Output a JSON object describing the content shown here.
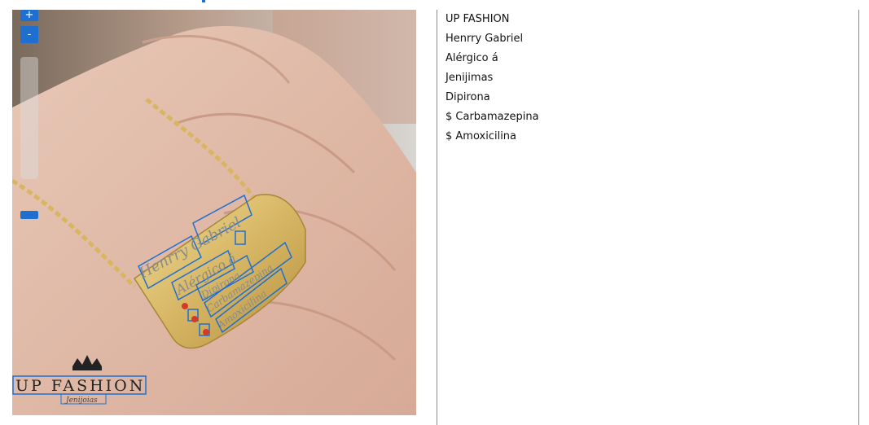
{
  "viewer": {
    "zoom_in_label": "+",
    "zoom_out_label": "-",
    "highlight_color": "#1f6fd1"
  },
  "image": {
    "logo_text": "UP FASHION",
    "logo_sub": "Jenijoias",
    "tag_line1": "Henrry Gabriel",
    "tag_line2": "Alérgico á",
    "tag_line3": "Dipirona",
    "tag_line4": "Carbamazepina",
    "tag_line5": "Amoxicilina"
  },
  "ocr_results": [
    "UP FASHION",
    "Henrry Gabriel",
    "Alérgico á",
    "Jenijimas",
    "Dipirona",
    "$ Carbamazepina",
    "$ Amoxicilina"
  ]
}
